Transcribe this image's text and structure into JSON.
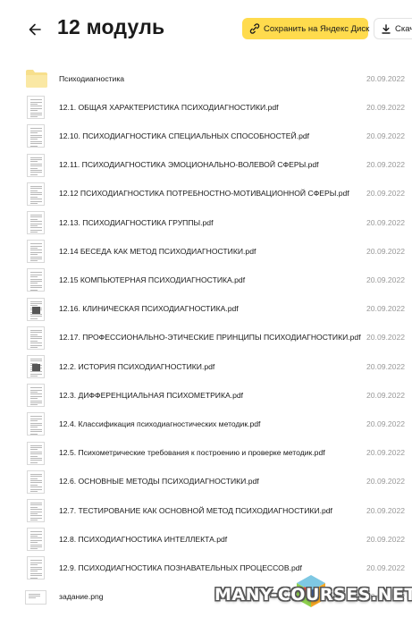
{
  "header": {
    "title": "12 модуль",
    "save_label": "Сохранить на Яндекс Диск",
    "download_label": "Скачать"
  },
  "files": [
    {
      "name": "Психодиагностика",
      "date": "20.09.2022",
      "type": "folder"
    },
    {
      "name": "12.1. ОБЩАЯ ХАРАКТЕРИСТИКА ПСИХОДИАГНОСТИКИ.pdf",
      "date": "20.09.2022",
      "type": "pdf"
    },
    {
      "name": "12.10. ПСИХОДИАГНОСТИКА СПЕЦИАЛЬНЫХ СПОСОБНОСТЕЙ.pdf",
      "date": "20.09.2022",
      "type": "pdf"
    },
    {
      "name": "12.11. ПСИХОДИАГНОСТИКА ЭМОЦИОНАЛЬНО-ВОЛЕВОЙ СФЕРЫ.pdf",
      "date": "20.09.2022",
      "type": "pdf"
    },
    {
      "name": "12.12 ПСИХОДИАГНОСТИКА ПОТРЕБНОСТНО-МОТИВАЦИОННОЙ СФЕРЫ.pdf",
      "date": "20.09.2022",
      "type": "pdf"
    },
    {
      "name": "12.13. ПСИХОДИАГНОСТИКА ГРУППЫ.pdf",
      "date": "20.09.2022",
      "type": "pdf"
    },
    {
      "name": "12.14 БЕСЕДА КАК МЕТОД ПСИХОДИАГНОСТИКИ.pdf",
      "date": "20.09.2022",
      "type": "pdf"
    },
    {
      "name": "12.15 КОМПЬЮТЕРНАЯ ПСИХОДИАГНОСТИКА.pdf",
      "date": "20.09.2022",
      "type": "pdf"
    },
    {
      "name": "12.16. КЛИНИЧЕСКАЯ ПСИХОДИАГНОСТИКА.pdf",
      "date": "20.09.2022",
      "type": "pdf"
    },
    {
      "name": "12.17. ПРОФЕССИОНАЛЬНО-ЭТИЧЕСКИЕ ПРИНЦИПЫ ПСИХОДИАГНОСТИКИ.pdf",
      "date": "20.09.2022",
      "type": "pdf"
    },
    {
      "name": "12.2. ИСТОРИЯ ПСИХОДИАГНОСТИКИ.pdf",
      "date": "20.09.2022",
      "type": "pdf"
    },
    {
      "name": "12.3. ДИФФЕРЕНЦИАЛЬНАЯ ПСИХОМЕТРИКА.pdf",
      "date": "20.09.2022",
      "type": "pdf"
    },
    {
      "name": "12.4. Классификация психодиагностических методик.pdf",
      "date": "20.09.2022",
      "type": "pdf"
    },
    {
      "name": "12.5. Психометрические требования к построению и проверке методик.pdf",
      "date": "20.09.2022",
      "type": "pdf"
    },
    {
      "name": "12.6. ОСНОВНЫЕ МЕТОДЫ ПСИХОДИАГНОСТИКИ.pdf",
      "date": "20.09.2022",
      "type": "pdf"
    },
    {
      "name": "12.7. ТЕСТИРОВАНИЕ КАК ОСНОВНОЙ МЕТОД ПСИХОДИАГНОСТИКИ.pdf",
      "date": "20.09.2022",
      "type": "pdf"
    },
    {
      "name": "12.8. ПСИХОДИАГНОСТИКА ИНТЕЛЛЕКТА.pdf",
      "date": "20.09.2022",
      "type": "pdf"
    },
    {
      "name": "12.9. ПСИХОДИАГНОСТИКА ПОЗНАВАТЕЛЬНЫХ ПРОЦЕССОВ.pdf",
      "date": "20.09.2022",
      "type": "pdf"
    },
    {
      "name": "задание.png",
      "date": "20.09.2022",
      "type": "png"
    }
  ],
  "watermark": {
    "text": "MANY-COURSES.NET"
  },
  "colors": {
    "accent": "#ffdb4d",
    "date": "#999999",
    "folder": "#f7df8c"
  }
}
